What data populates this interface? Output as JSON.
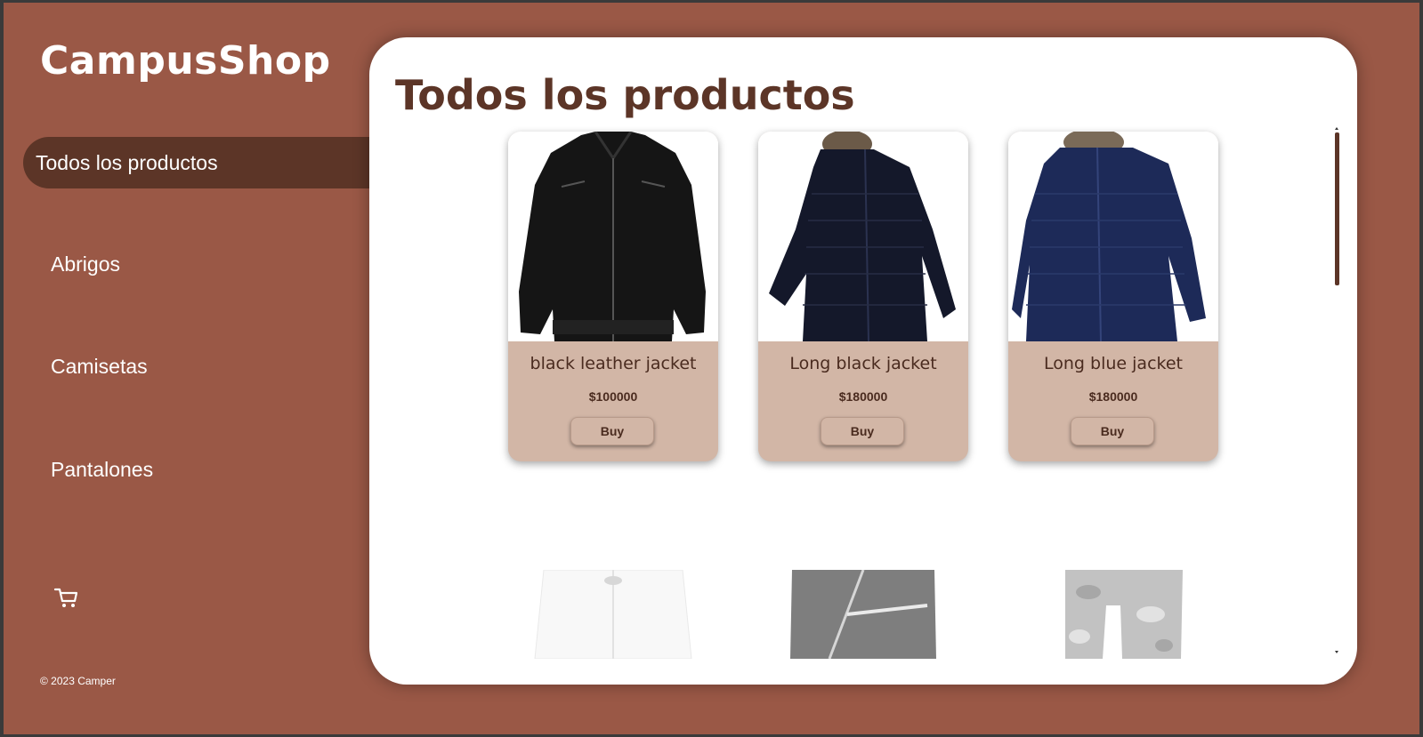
{
  "brand": "CampusShop",
  "nav": {
    "items": [
      {
        "label": "Todos los productos"
      },
      {
        "label": "Abrigos"
      },
      {
        "label": "Camisetas"
      },
      {
        "label": "Pantalones"
      }
    ],
    "active_index": 0,
    "cart_icon": "cart-icon"
  },
  "footer": "© 2023 Camper",
  "main": {
    "title": "Todos los productos",
    "products": [
      {
        "name": "black leather jacket",
        "price": "$100000",
        "buy_label": "Buy"
      },
      {
        "name": "Long black jacket",
        "price": "$180000",
        "buy_label": "Buy"
      },
      {
        "name": "Long blue jacket",
        "price": "$180000",
        "buy_label": "Buy"
      }
    ],
    "next_row_images": [
      "white-coat-image",
      "black-zip-jacket-image",
      "camo-pants-image"
    ]
  },
  "colors": {
    "sidebar_bg": "#9a5846",
    "active_nav_bg": "#5c3527",
    "card_bg": "#d2b6a6",
    "title_color": "#5c3527"
  }
}
